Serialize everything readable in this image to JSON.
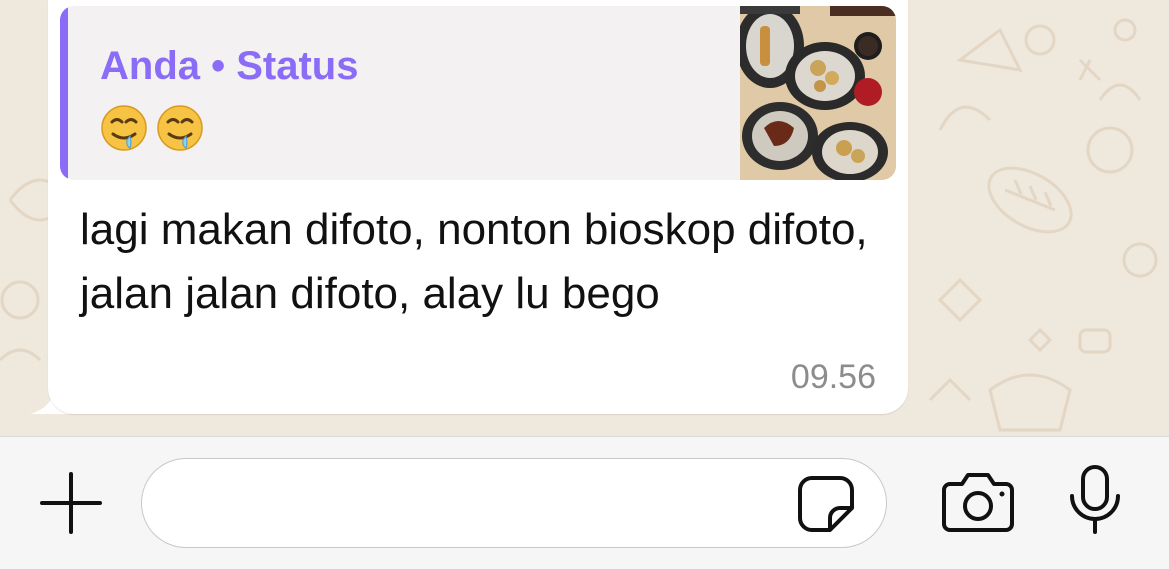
{
  "chat": {
    "reply_quote": {
      "author": "Anda • Status",
      "emojis": [
        "drooling-face",
        "drooling-face"
      ],
      "thumbnail": "food-photo-thumbnail",
      "accent_color": "#8a6cf7"
    },
    "message": {
      "text": "lagi makan difoto, nonton bioskop difoto, jalan jalan difoto, alay lu bego",
      "time": "09.56"
    }
  },
  "input_bar": {
    "placeholder": "",
    "icons": [
      "plus-icon",
      "sticker-icon",
      "camera-icon",
      "microphone-icon"
    ]
  },
  "colors": {
    "wallpaper": "#efe8dc",
    "bubble": "#ffffff",
    "quote_background": "#f3f1f2",
    "timestamp": "#8c8c8c",
    "input_bar": "#f6f6f6"
  }
}
